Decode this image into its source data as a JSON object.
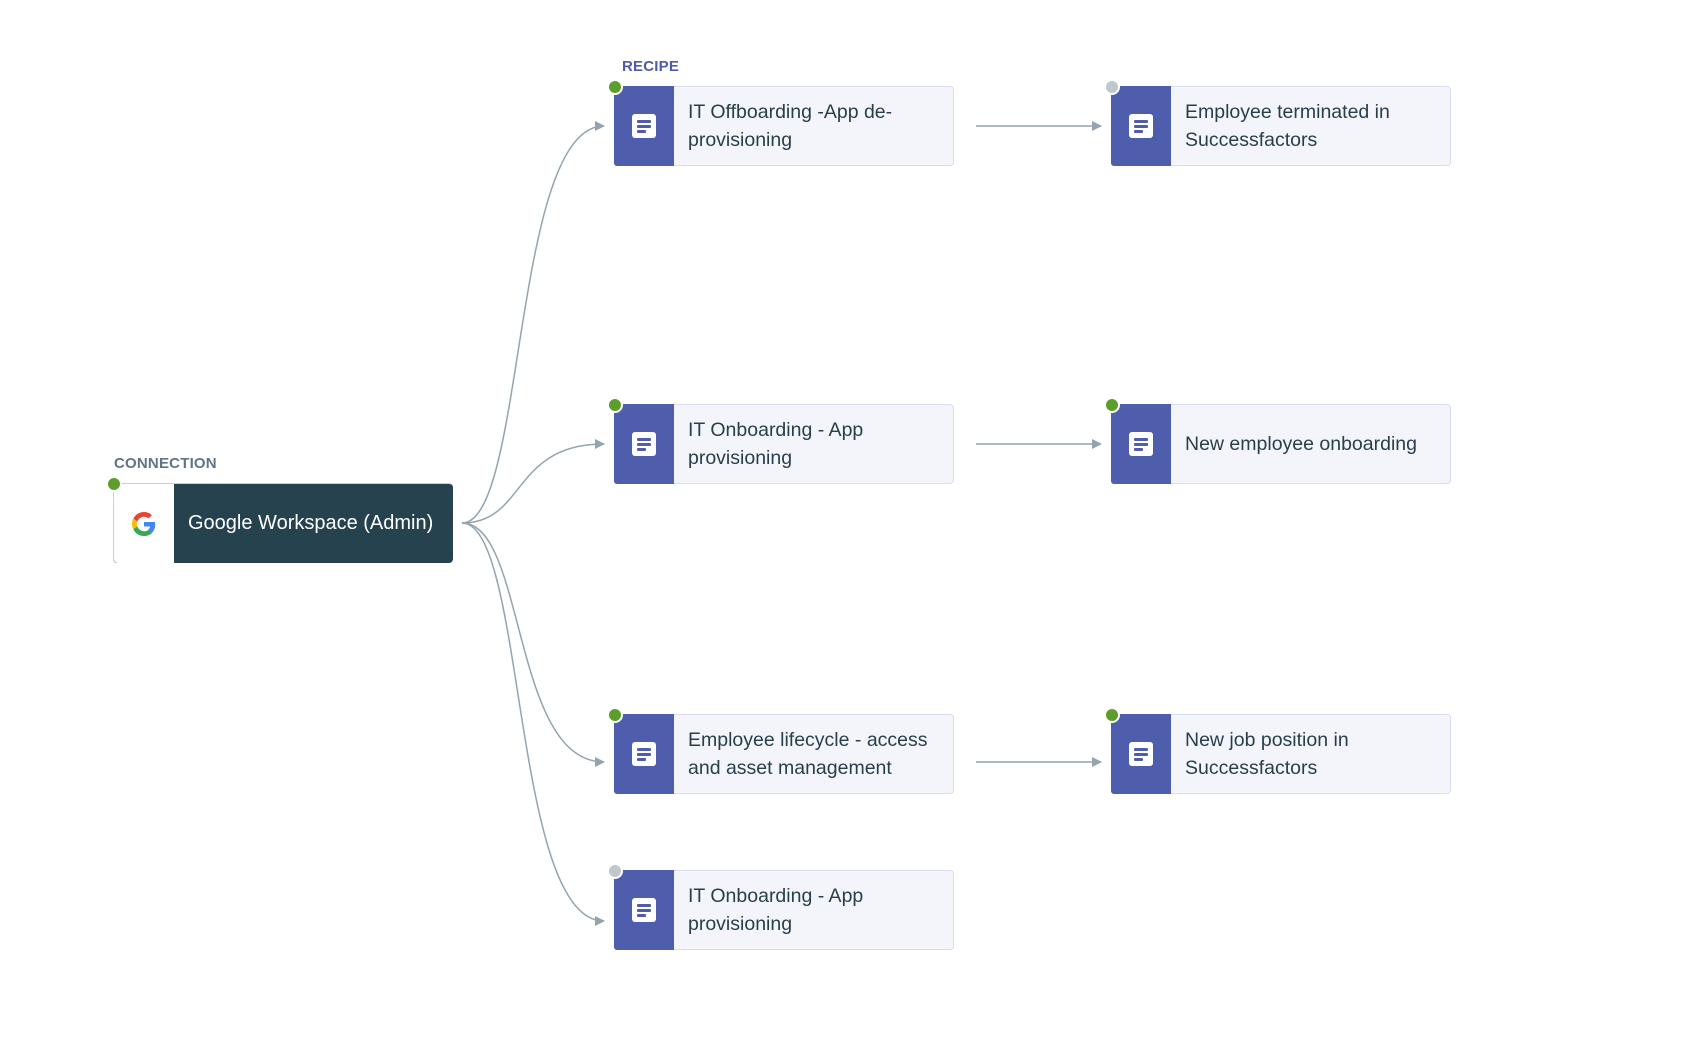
{
  "labels": {
    "connection": "CONNECTION",
    "recipe": "RECIPE"
  },
  "colors": {
    "connection_bg": "#25424e",
    "recipe_accent": "#4e5eac",
    "card_bg": "#f4f5fb",
    "edge": "#94a4ae",
    "status_active": "#5d9e2b",
    "status_inactive": "#bfc7cf"
  },
  "connection": {
    "name": "Google Workspace (Admin)",
    "icon": "google-g-icon",
    "status": "active"
  },
  "recipes": [
    {
      "id": "r1",
      "name": "IT Offboarding -App de-provisioning",
      "status": "active",
      "icon": "document-icon"
    },
    {
      "id": "r2",
      "name": "IT Onboarding -  App provisioning",
      "status": "active",
      "icon": "document-icon"
    },
    {
      "id": "r3",
      "name": "Employee lifecycle - access and asset management",
      "status": "active",
      "icon": "document-icon"
    },
    {
      "id": "r4",
      "name": "IT Onboarding -  App provisioning",
      "status": "inactive",
      "icon": "document-icon"
    }
  ],
  "downstream": [
    {
      "id": "d1",
      "name": "Employee terminated in Successfactors",
      "status": "inactive",
      "from": "r1",
      "icon": "document-icon"
    },
    {
      "id": "d2",
      "name": "New employee onboarding",
      "status": "active",
      "from": "r2",
      "icon": "document-icon"
    },
    {
      "id": "d3",
      "name": "New job position in Successfactors",
      "status": "active",
      "from": "r3",
      "icon": "document-icon"
    }
  ],
  "edges": [
    {
      "from": "connection",
      "to": "r1"
    },
    {
      "from": "connection",
      "to": "r2"
    },
    {
      "from": "connection",
      "to": "r3"
    },
    {
      "from": "connection",
      "to": "r4"
    },
    {
      "from": "r1",
      "to": "d1"
    },
    {
      "from": "r2",
      "to": "d2"
    },
    {
      "from": "r3",
      "to": "d3"
    }
  ]
}
